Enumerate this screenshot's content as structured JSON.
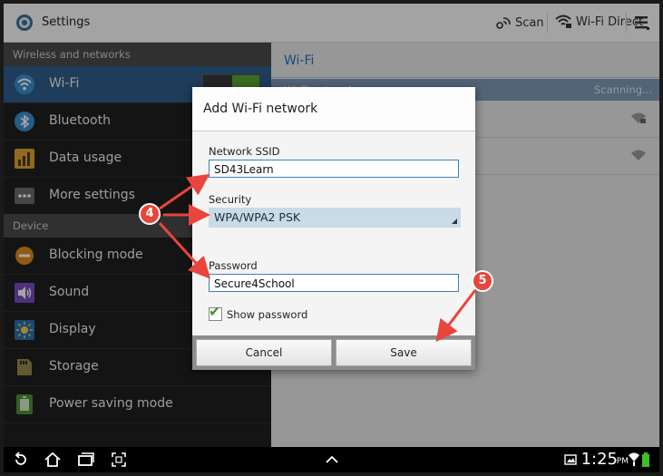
{
  "topbar": {
    "title": "Settings",
    "actions": {
      "scan": "Scan",
      "wifi_direct": "Wi-Fi Direct"
    }
  },
  "sidebar": {
    "sections": {
      "wireless": "Wireless and networks",
      "device": "Device"
    },
    "items": [
      {
        "label": "Wi-Fi",
        "icon": "wifi-icon",
        "selected": true
      },
      {
        "label": "Bluetooth",
        "icon": "bluetooth-icon"
      },
      {
        "label": "Data usage",
        "icon": "data-usage-icon"
      },
      {
        "label": "More settings",
        "icon": "more-icon"
      },
      {
        "label": "Blocking mode",
        "icon": "blocking-icon"
      },
      {
        "label": "Sound",
        "icon": "sound-icon"
      },
      {
        "label": "Display",
        "icon": "display-icon"
      },
      {
        "label": "Storage",
        "icon": "storage-icon"
      },
      {
        "label": "Power saving mode",
        "icon": "power-saving-icon"
      }
    ]
  },
  "main": {
    "heading": "Wi-Fi",
    "networks_label": "Wi-Fi networks",
    "scanning": "Scanning..."
  },
  "dialog": {
    "title": "Add Wi-Fi network",
    "ssid_label": "Network SSID",
    "ssid_value": "SD43Learn",
    "security_label": "Security",
    "security_value": "WPA/WPA2 PSK",
    "password_label": "Password",
    "password_value": "Secure4School",
    "show_password_label": "Show password",
    "show_password_checked": true,
    "cancel_label": "Cancel",
    "save_label": "Save"
  },
  "status": {
    "time": "1:25",
    "ampm": "PM"
  },
  "annotations": {
    "step_a": "4",
    "step_b": "5"
  },
  "colors": {
    "accent": "#2a73b8",
    "selected_row": "#2f5e8a",
    "callout": "#e8453c",
    "toggle_on": "#5aa832"
  }
}
